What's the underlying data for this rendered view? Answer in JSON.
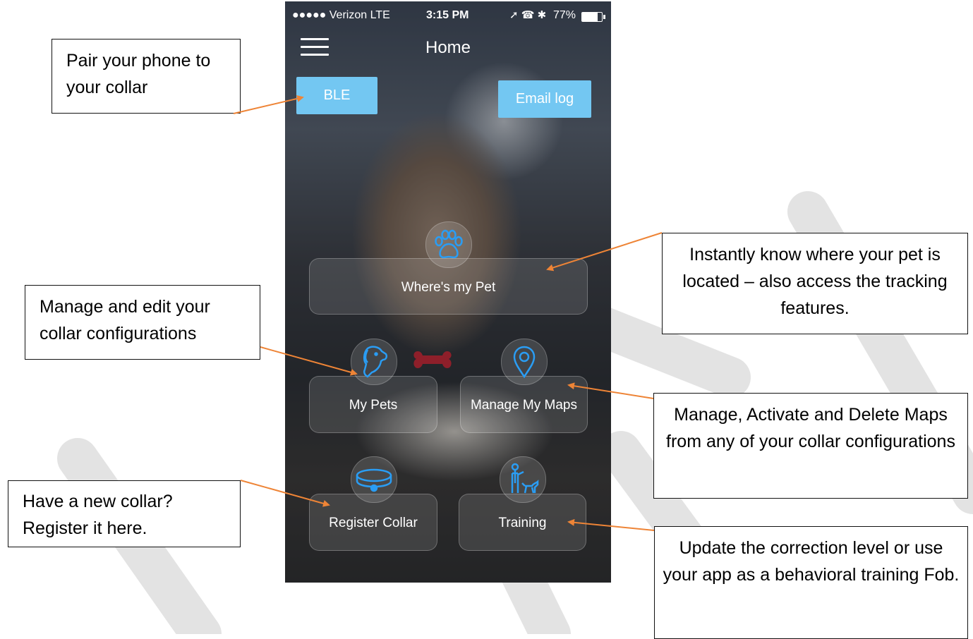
{
  "status_bar": {
    "carrier": "●●●●● Verizon  LTE",
    "time": "3:15 PM",
    "icons": "➚ ☎ ✱",
    "battery_text": "77%",
    "battery_level": 0.77
  },
  "header": {
    "title": "Home"
  },
  "buttons": {
    "ble": "BLE",
    "email_log": "Email log"
  },
  "tiles": {
    "wheres_my_pet": "Where's my Pet",
    "my_pets": "My Pets",
    "manage_my_maps": "Manage My Maps",
    "register_collar": "Register Collar",
    "training": "Training"
  },
  "callouts": {
    "pair": "Pair your phone to your collar",
    "manage": "Manage and edit your collar configurations",
    "new_collar": "Have a new collar? Register it here.",
    "locate": "Instantly know where your pet is located – also access the tracking features.",
    "maps": "Manage, Activate and Delete Maps from any of your collar configurations",
    "training": "Update the correction level or use your app as a behavioral training Fob."
  },
  "colors": {
    "accent_button": "#73c7f2",
    "icon_blue": "#2a9df4",
    "arrow": "#ee8436",
    "tag_red": "#8e1f2a"
  }
}
